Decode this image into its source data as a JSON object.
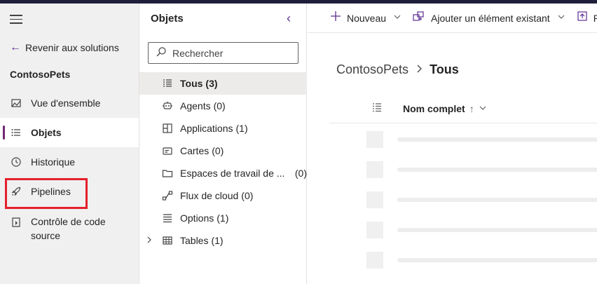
{
  "nav": {
    "back_label": "Revenir aux solutions",
    "solution_name": "ContosoPets",
    "items": [
      {
        "label": "Vue d'ensemble",
        "icon": "overview-icon"
      },
      {
        "label": "Objets",
        "icon": "list-icon",
        "selected": true
      },
      {
        "label": "Historique",
        "icon": "history-icon"
      },
      {
        "label": "Pipelines",
        "icon": "rocket-icon"
      },
      {
        "label": "Contrôle de code source",
        "icon": "source-control-icon"
      }
    ],
    "accent": "#742774",
    "highlight_color": "#e3202c"
  },
  "objects": {
    "title": "Objets",
    "search_placeholder": "Rechercher",
    "items": [
      {
        "label": "Tous",
        "count": "(3)",
        "icon": "list-icon",
        "selected": true
      },
      {
        "label": "Agents",
        "count": "(0)",
        "icon": "agent-icon"
      },
      {
        "label": "Applications",
        "count": "(1)",
        "icon": "apps-icon"
      },
      {
        "label": "Cartes",
        "count": "(0)",
        "icon": "card-icon"
      },
      {
        "label": "Espaces de travail de ...",
        "count": "(0)",
        "icon": "folder-icon"
      },
      {
        "label": "Flux de cloud",
        "count": "(0)",
        "icon": "flow-icon"
      },
      {
        "label": "Options",
        "count": "(1)",
        "icon": "options-icon"
      },
      {
        "label": "Tables",
        "count": "(1)",
        "icon": "table-icon"
      }
    ]
  },
  "toolbar": {
    "new_label": "Nouveau",
    "add_existing_label": "Ajouter un élément existant",
    "publish_label": "Pu"
  },
  "breadcrumb": {
    "root": "ContosoPets",
    "current": "Tous"
  },
  "table": {
    "column_name": "Nom complet",
    "sort_symbol": "↑"
  }
}
